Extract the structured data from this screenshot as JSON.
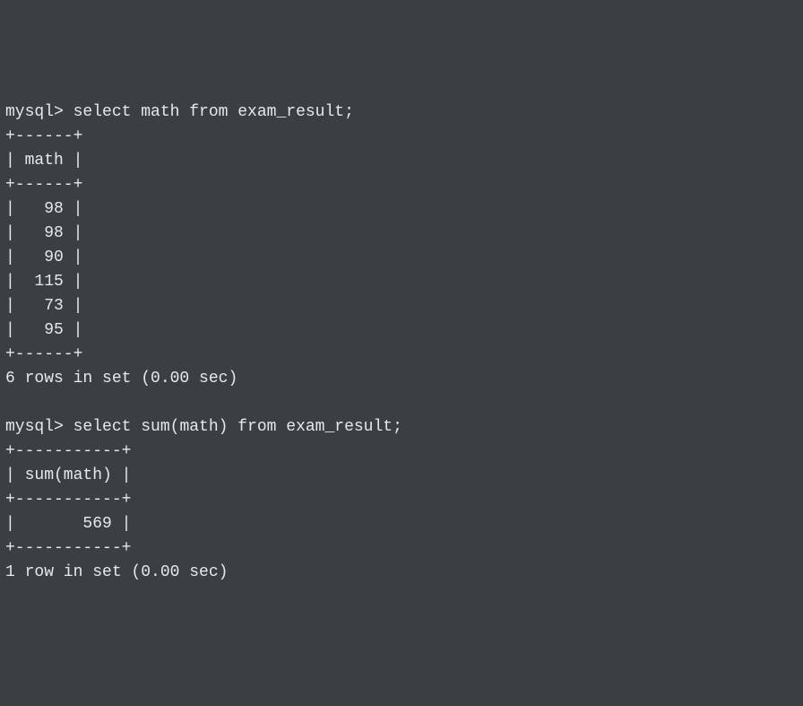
{
  "prompt": "mysql> ",
  "query1": {
    "sql": "select math from exam_result;",
    "border_top": "+------+",
    "header_row": "| math |",
    "border_mid": "+------+",
    "rows": [
      "|   98 |",
      "|   98 |",
      "|   90 |",
      "|  115 |",
      "|   73 |",
      "|   95 |"
    ],
    "border_bot": "+------+",
    "status": "6 rows in set (0.00 sec)"
  },
  "query2": {
    "sql": "select sum(math) from exam_result;",
    "border_top": "+-----------+",
    "header_row": "| sum(math) |",
    "border_mid": "+-----------+",
    "rows": [
      "|       569 |"
    ],
    "border_bot": "+-----------+",
    "status": "1 row in set (0.00 sec)"
  },
  "chart_data": [
    {
      "type": "table",
      "title": "exam_result.math",
      "columns": [
        "math"
      ],
      "rows": [
        [
          98
        ],
        [
          98
        ],
        [
          90
        ],
        [
          115
        ],
        [
          73
        ],
        [
          95
        ]
      ]
    },
    {
      "type": "table",
      "title": "sum(math)",
      "columns": [
        "sum(math)"
      ],
      "rows": [
        [
          569
        ]
      ]
    }
  ]
}
